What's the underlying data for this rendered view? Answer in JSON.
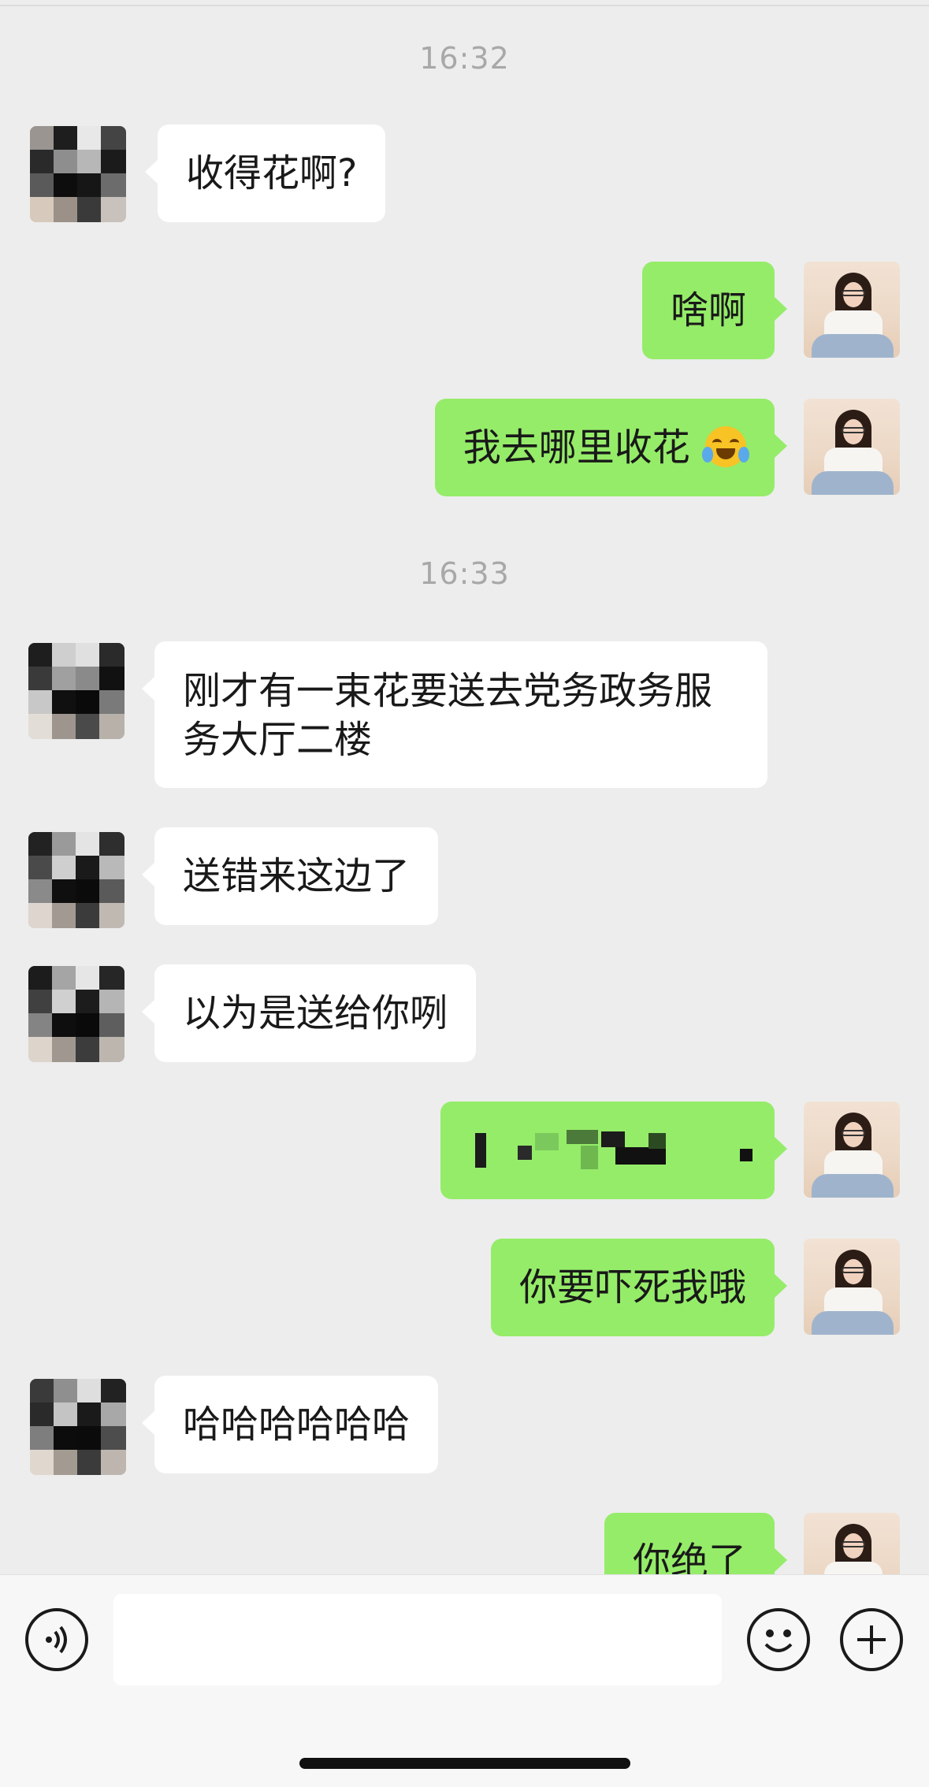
{
  "timestamps": [
    "16:32",
    "16:33"
  ],
  "messages": [
    {
      "side": "in",
      "text": "收得花啊?"
    },
    {
      "side": "out",
      "text": "啥啊"
    },
    {
      "side": "out",
      "text": "我去哪里收花",
      "emoji": "crying-laughing-emoji-icon"
    },
    {
      "side": "in",
      "text": "刚才有一束花要送去党务政务服务大厅二楼"
    },
    {
      "side": "in",
      "text": "送错来这边了"
    },
    {
      "side": "in",
      "text": "以为是送给你咧"
    },
    {
      "side": "out",
      "text": "",
      "note": "pixelated-content"
    },
    {
      "side": "out",
      "text": "你要吓死我哦"
    },
    {
      "side": "in",
      "text": "哈哈哈哈哈哈"
    },
    {
      "side": "out",
      "text": "你绝了"
    }
  ],
  "input": {
    "value": "",
    "placeholder": ""
  },
  "icons": {
    "voice": "voice-icon",
    "emoji": "emoji-icon",
    "plus": "plus-icon"
  },
  "colors": {
    "background": "#ededed",
    "incoming_bubble": "#ffffff",
    "outgoing_bubble": "#95ec69",
    "timestamp": "#a8a8a8"
  }
}
